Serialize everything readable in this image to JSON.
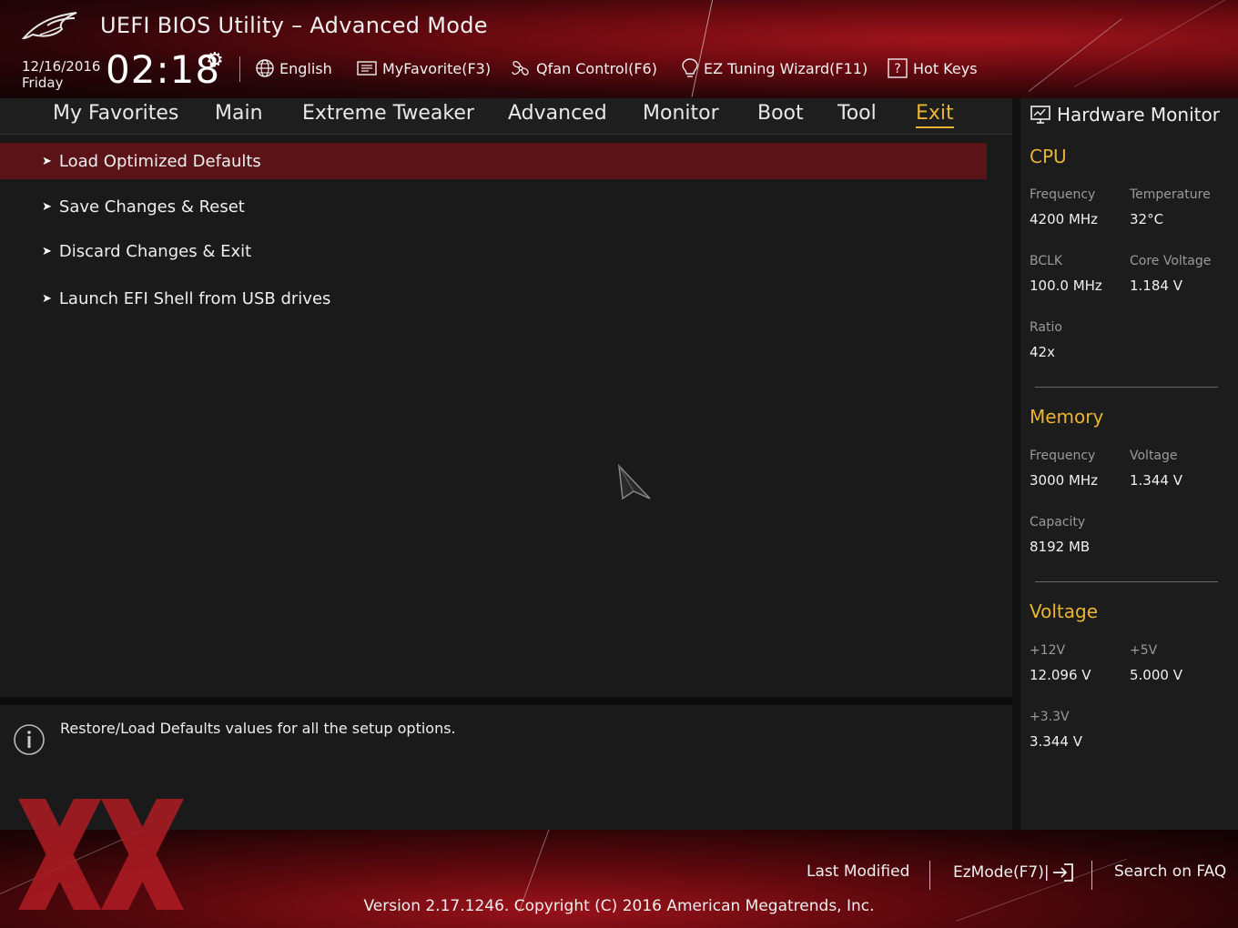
{
  "header": {
    "title": "UEFI BIOS Utility – Advanced Mode",
    "date": "12/16/2016",
    "day": "Friday",
    "time": "02:18",
    "toolbar": {
      "language": "English",
      "my_favorite": "MyFavorite(F3)",
      "qfan": "Qfan Control(F6)",
      "ez_tuning": "EZ Tuning Wizard(F11)",
      "hot_keys": "Hot Keys"
    }
  },
  "nav": {
    "tabs": [
      "My Favorites",
      "Main",
      "Extreme Tweaker",
      "Advanced",
      "Monitor",
      "Boot",
      "Tool",
      "Exit"
    ],
    "active": "Exit"
  },
  "menu": {
    "items": [
      "Load Optimized Defaults",
      "Save Changes & Reset",
      "Discard Changes & Exit",
      "Launch EFI Shell from USB drives"
    ],
    "selected_index": 0
  },
  "help": {
    "text": "Restore/Load Defaults values for all the setup options."
  },
  "hardware_monitor": {
    "title": "Hardware Monitor",
    "cpu": {
      "heading": "CPU",
      "frequency_label": "Frequency",
      "frequency": "4200 MHz",
      "temperature_label": "Temperature",
      "temperature": "32°C",
      "bclk_label": "BCLK",
      "bclk": "100.0 MHz",
      "core_voltage_label": "Core Voltage",
      "core_voltage": "1.184 V",
      "ratio_label": "Ratio",
      "ratio": "42x"
    },
    "memory": {
      "heading": "Memory",
      "frequency_label": "Frequency",
      "frequency": "3000 MHz",
      "voltage_label": "Voltage",
      "voltage": "1.344 V",
      "capacity_label": "Capacity",
      "capacity": "8192 MB"
    },
    "voltage": {
      "heading": "Voltage",
      "v12_label": "+12V",
      "v12": "12.096 V",
      "v5_label": "+5V",
      "v5": "5.000 V",
      "v33_label": "+3.3V",
      "v33": "3.344 V"
    }
  },
  "footer": {
    "last_modified": "Last Modified",
    "ez_mode": "EzMode(F7)|",
    "search_faq": "Search on FAQ",
    "version": "Version 2.17.1246. Copyright (C) 2016 American Megatrends, Inc."
  },
  "colors": {
    "accent": "#e8b533",
    "selected_row": "#5a1418",
    "brand_red": "#a0141c"
  }
}
